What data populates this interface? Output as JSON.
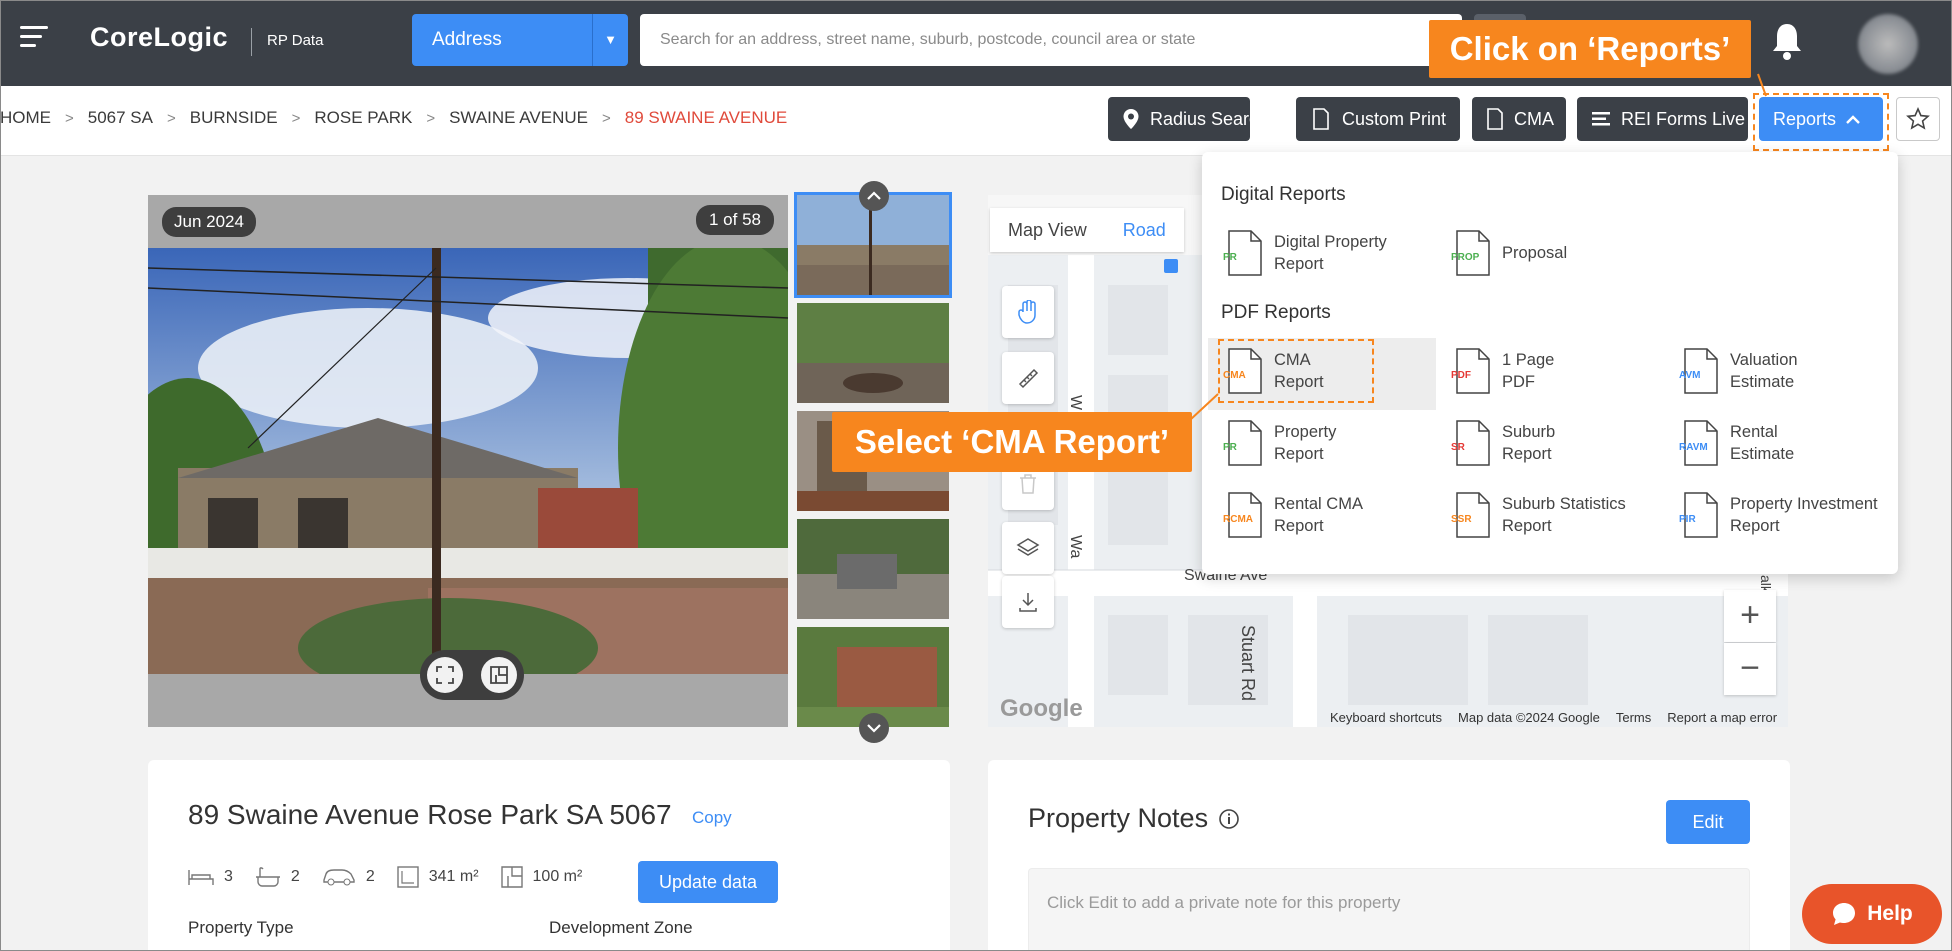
{
  "header": {
    "logo_text": "CoreLogic",
    "logo_sub": "RP Data",
    "search_type": "Address",
    "search_placeholder": "Search for an address, street name, suburb, postcode, council area or state"
  },
  "annotations": {
    "click_reports": "Click on ‘Reports’",
    "select_cma": "Select ‘CMA Report’"
  },
  "breadcrumb": {
    "items": [
      "HOME",
      "5067 SA",
      "BURNSIDE",
      "ROSE PARK",
      "SWAINE AVENUE"
    ],
    "current": "89 SWAINE AVENUE"
  },
  "toolbar": {
    "radius_search": "Radius Search",
    "custom_print": "Custom Print",
    "cma": "CMA",
    "rei_forms": "REI Forms Live",
    "reports": "Reports"
  },
  "gallery": {
    "date": "Jun 2024",
    "count": "1 of 58"
  },
  "map": {
    "tab_map_view": "Map View",
    "tab_road": "Road",
    "street_1": "Swaine Ave",
    "street_2": "Stuart Rd",
    "street_3": "W",
    "street_4": "Wa",
    "street_5": "alk",
    "google_wordmark": "Google",
    "footer": [
      "Keyboard shortcuts",
      "Map data ©2024 Google",
      "Terms",
      "Report a map error"
    ]
  },
  "reports_menu": {
    "digital_heading": "Digital Reports",
    "pdf_heading": "PDF Reports",
    "digital_items": [
      {
        "tag": "PR",
        "label1": "Digital Property",
        "label2": "Report",
        "color": "#4caf50"
      },
      {
        "tag": "PROP",
        "label1": "Proposal",
        "label2": "",
        "color": "#4caf50"
      }
    ],
    "pdf_items": [
      {
        "tag": "CMA",
        "label1": "CMA",
        "label2": "Report",
        "color": "#f7861e"
      },
      {
        "tag": "PDF",
        "label1": "1 Page",
        "label2": "PDF",
        "color": "#e53935"
      },
      {
        "tag": "AVM",
        "label1": "Valuation",
        "label2": "Estimate",
        "color": "#3d8df5"
      },
      {
        "tag": "PR",
        "label1": "Property",
        "label2": "Report",
        "color": "#4caf50"
      },
      {
        "tag": "SR",
        "label1": "Suburb",
        "label2": "Report",
        "color": "#e53935"
      },
      {
        "tag": "RAVM",
        "label1": "Rental",
        "label2": "Estimate",
        "color": "#3d8df5"
      },
      {
        "tag": "RCMA",
        "label1": "Rental CMA",
        "label2": "Report",
        "color": "#f7861e"
      },
      {
        "tag": "SSR",
        "label1": "Suburb Statistics",
        "label2": "Report",
        "color": "#f7861e"
      },
      {
        "tag": "PIR",
        "label1": "Property Investment",
        "label2": "Report",
        "color": "#3d8df5"
      }
    ]
  },
  "property": {
    "address": "89 Swaine Avenue Rose Park SA 5067",
    "copy": "Copy",
    "beds": "3",
    "baths": "2",
    "cars": "2",
    "land": "341 m²",
    "floor": "100 m²",
    "update_btn": "Update data",
    "type_label": "Property Type",
    "zone_label": "Development Zone"
  },
  "notes": {
    "title": "Property Notes",
    "edit": "Edit",
    "placeholder": "Click Edit to add a private note for this property"
  },
  "help": "Help",
  "colors": {
    "topbar": "#3b4047",
    "accent": "#3d8df5",
    "callout": "#f7861e",
    "breadcrumb_current": "#e04a3b"
  }
}
